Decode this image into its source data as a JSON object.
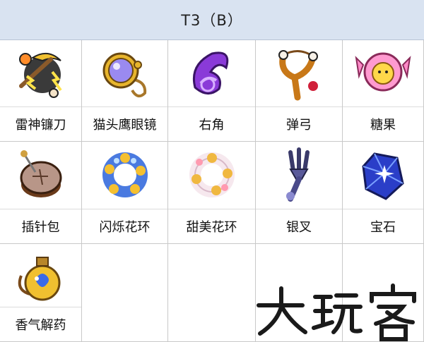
{
  "header": {
    "title": "T3（B）"
  },
  "items": [
    {
      "label": "雷神镰刀",
      "icon": "thunder-scythe-icon"
    },
    {
      "label": "猫头鹰眼镜",
      "icon": "owl-monocle-icon"
    },
    {
      "label": "右角",
      "icon": "right-horn-icon"
    },
    {
      "label": "弹弓",
      "icon": "slingshot-icon"
    },
    {
      "label": "糖果",
      "icon": "candy-icon"
    },
    {
      "label": "插针包",
      "icon": "pincushion-icon"
    },
    {
      "label": "闪烁花环",
      "icon": "sparkling-wreath-icon"
    },
    {
      "label": "甜美花环",
      "icon": "sweet-wreath-icon"
    },
    {
      "label": "银叉",
      "icon": "silver-fork-icon"
    },
    {
      "label": "宝石",
      "icon": "gem-icon"
    },
    {
      "label": "香气解药",
      "icon": "fragrant-antidote-icon"
    }
  ],
  "watermark": {
    "text": "大玩客"
  }
}
